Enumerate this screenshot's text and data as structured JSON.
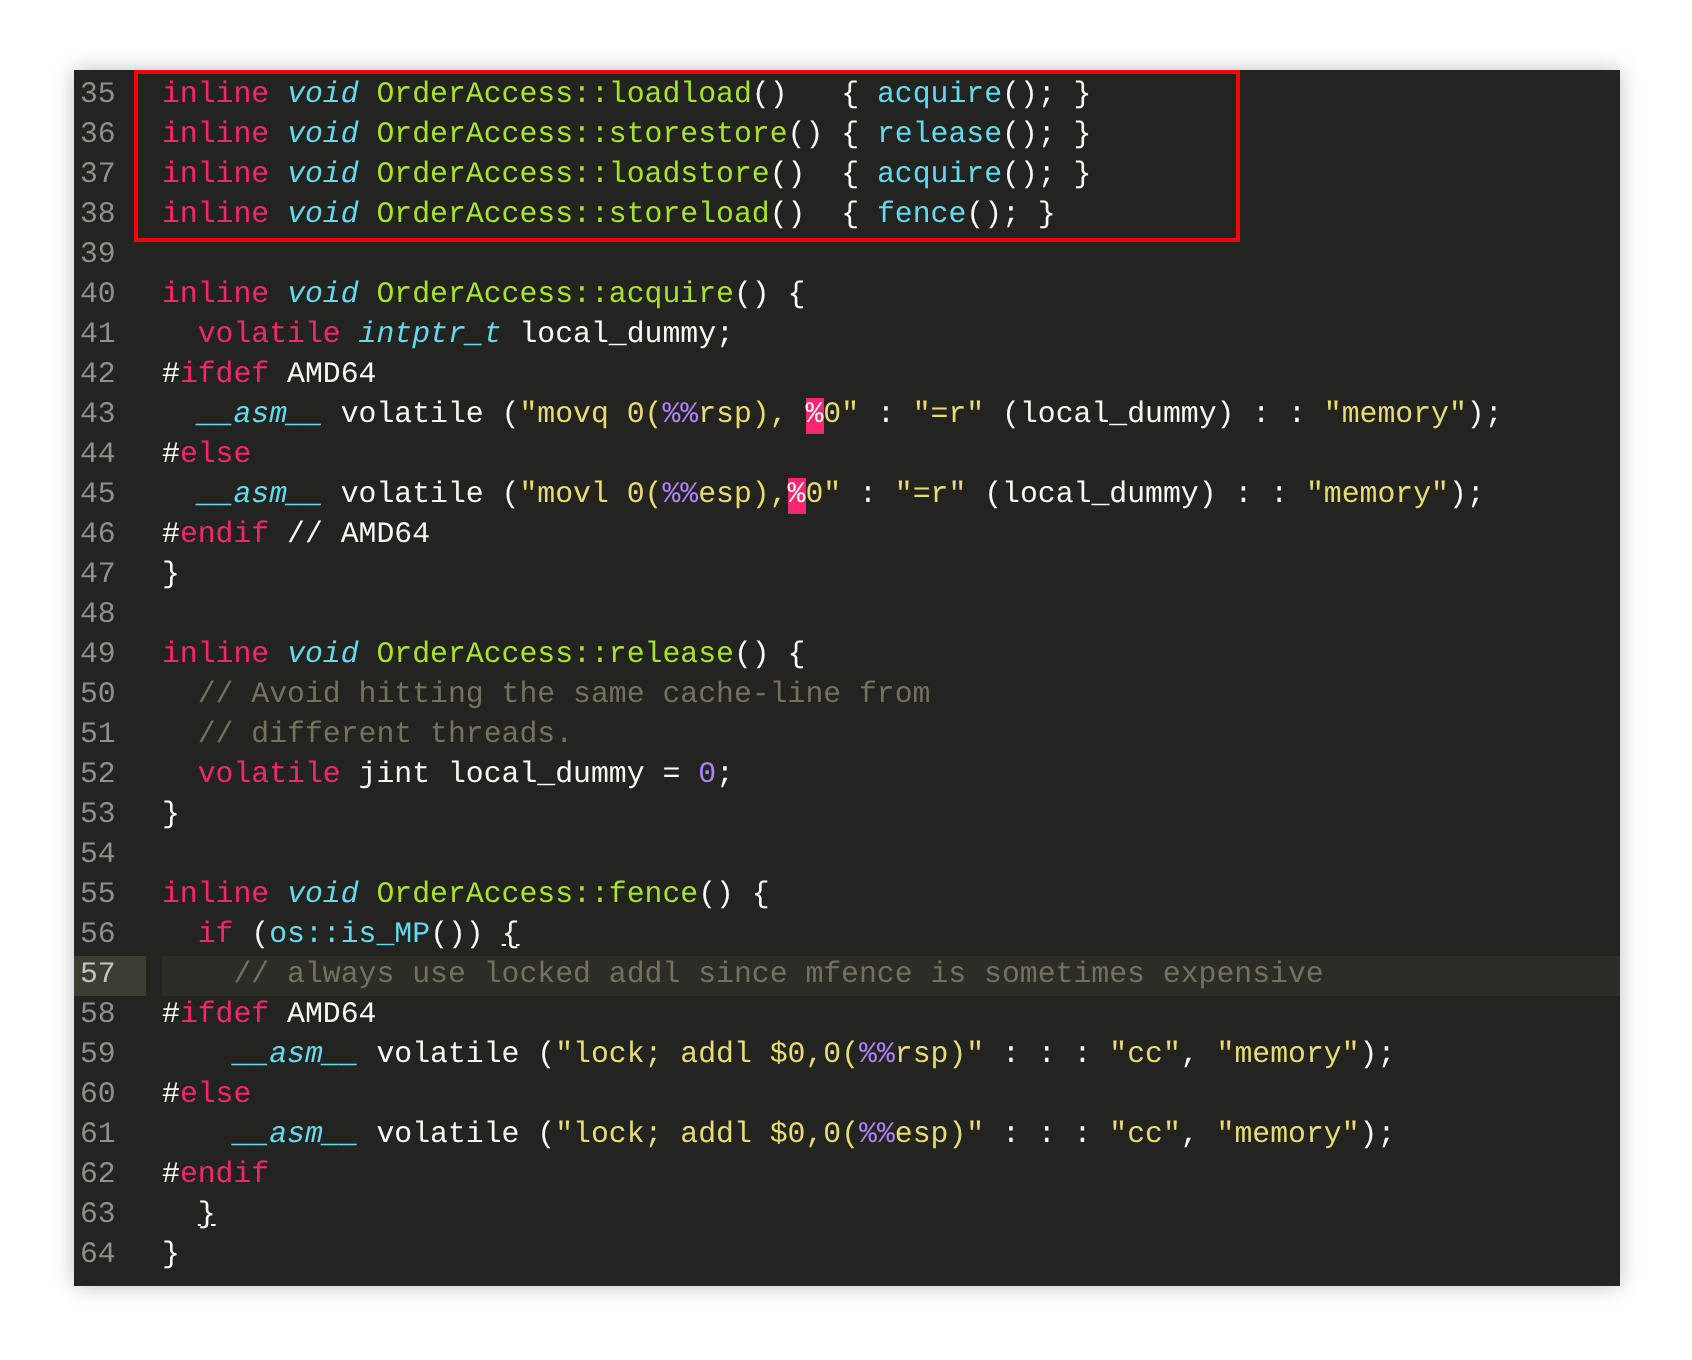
{
  "editor": {
    "lines": [
      {
        "number": "35",
        "current": false,
        "boxed": true,
        "tokens": [
          {
            "kind": "keyword",
            "t": "inline "
          },
          {
            "kind": "type",
            "t": "void"
          },
          {
            "kind": "function",
            "t": " OrderAccess::loadload"
          },
          {
            "kind": "plain",
            "t": "()   { "
          },
          {
            "kind": "call",
            "t": "acquire"
          },
          {
            "kind": "plain",
            "t": "(); }"
          }
        ]
      },
      {
        "number": "36",
        "current": false,
        "boxed": true,
        "tokens": [
          {
            "kind": "keyword",
            "t": "inline "
          },
          {
            "kind": "type",
            "t": "void"
          },
          {
            "kind": "function",
            "t": " OrderAccess::storestore"
          },
          {
            "kind": "plain",
            "t": "() { "
          },
          {
            "kind": "call",
            "t": "release"
          },
          {
            "kind": "plain",
            "t": "(); }"
          }
        ]
      },
      {
        "number": "37",
        "current": false,
        "boxed": true,
        "tokens": [
          {
            "kind": "keyword",
            "t": "inline "
          },
          {
            "kind": "type",
            "t": "void"
          },
          {
            "kind": "function",
            "t": " OrderAccess::loadstore"
          },
          {
            "kind": "plain",
            "t": "()  { "
          },
          {
            "kind": "call",
            "t": "acquire"
          },
          {
            "kind": "plain",
            "t": "(); }"
          }
        ]
      },
      {
        "number": "38",
        "current": false,
        "boxed": true,
        "tokens": [
          {
            "kind": "keyword",
            "t": "inline "
          },
          {
            "kind": "type",
            "t": "void"
          },
          {
            "kind": "function",
            "t": " OrderAccess::storeload"
          },
          {
            "kind": "plain",
            "t": "()  { "
          },
          {
            "kind": "call",
            "t": "fence"
          },
          {
            "kind": "plain",
            "t": "(); }"
          }
        ]
      },
      {
        "number": "39",
        "current": false
      },
      {
        "number": "40",
        "current": false,
        "tokens": [
          {
            "kind": "keyword",
            "t": "inline "
          },
          {
            "kind": "type",
            "t": "void"
          },
          {
            "kind": "function",
            "t": " OrderAccess::acquire"
          },
          {
            "kind": "plain",
            "t": "() {"
          }
        ]
      },
      {
        "number": "41",
        "current": false,
        "tokens": [
          {
            "kind": "keyword",
            "t": "  volatile "
          },
          {
            "kind": "type",
            "t": "intptr_t"
          },
          {
            "kind": "plain",
            "t": " local_dummy;"
          }
        ]
      },
      {
        "number": "42",
        "current": false,
        "tokens": [
          {
            "kind": "plain",
            "t": "#"
          },
          {
            "kind": "keyword",
            "t": "ifdef"
          },
          {
            "kind": "plain",
            "t": " AMD64"
          }
        ]
      },
      {
        "number": "43",
        "current": false,
        "tokens": [
          {
            "kind": "type",
            "t": "  __asm__"
          },
          {
            "kind": "plain",
            "t": " volatile ("
          },
          {
            "kind": "string",
            "t": "\"movq 0("
          },
          {
            "kind": "escape",
            "t": "%%"
          },
          {
            "kind": "string",
            "t": "rsp), "
          },
          {
            "kind": "invalid",
            "t": "%"
          },
          {
            "kind": "string",
            "t": "0\""
          },
          {
            "kind": "plain",
            "t": " : "
          },
          {
            "kind": "string",
            "t": "\"=r\""
          },
          {
            "kind": "plain",
            "t": " (local_dummy) : : "
          },
          {
            "kind": "string",
            "t": "\"memory\""
          },
          {
            "kind": "plain",
            "t": ");"
          }
        ]
      },
      {
        "number": "44",
        "current": false,
        "tokens": [
          {
            "kind": "plain",
            "t": "#"
          },
          {
            "kind": "keyword",
            "t": "else"
          }
        ]
      },
      {
        "number": "45",
        "current": false,
        "tokens": [
          {
            "kind": "type",
            "t": "  __asm__"
          },
          {
            "kind": "plain",
            "t": " volatile ("
          },
          {
            "kind": "string",
            "t": "\"movl 0("
          },
          {
            "kind": "escape",
            "t": "%%"
          },
          {
            "kind": "string",
            "t": "esp),"
          },
          {
            "kind": "invalid",
            "t": "%"
          },
          {
            "kind": "string",
            "t": "0\""
          },
          {
            "kind": "plain",
            "t": " : "
          },
          {
            "kind": "string",
            "t": "\"=r\""
          },
          {
            "kind": "plain",
            "t": " (local_dummy) : : "
          },
          {
            "kind": "string",
            "t": "\"memory\""
          },
          {
            "kind": "plain",
            "t": ");"
          }
        ]
      },
      {
        "number": "46",
        "current": false,
        "tokens": [
          {
            "kind": "plain",
            "t": "#"
          },
          {
            "kind": "keyword",
            "t": "endif"
          },
          {
            "kind": "plain",
            "t": " // AMD64"
          }
        ]
      },
      {
        "number": "47",
        "current": false,
        "tokens": [
          {
            "kind": "plain",
            "t": "}"
          }
        ]
      },
      {
        "number": "48",
        "current": false
      },
      {
        "number": "49",
        "current": false,
        "tokens": [
          {
            "kind": "keyword",
            "t": "inline "
          },
          {
            "kind": "type",
            "t": "void"
          },
          {
            "kind": "function",
            "t": " OrderAccess::release"
          },
          {
            "kind": "plain",
            "t": "() {"
          }
        ]
      },
      {
        "number": "50",
        "current": false,
        "tokens": [
          {
            "kind": "comment",
            "t": "  // Avoid hitting the same cache-line from"
          }
        ]
      },
      {
        "number": "51",
        "current": false,
        "tokens": [
          {
            "kind": "comment",
            "t": "  // different threads."
          }
        ]
      },
      {
        "number": "52",
        "current": false,
        "tokens": [
          {
            "kind": "keyword",
            "t": "  volatile"
          },
          {
            "kind": "plain",
            "t": " jint local_dummy = "
          },
          {
            "kind": "number",
            "t": "0"
          },
          {
            "kind": "plain",
            "t": ";"
          }
        ]
      },
      {
        "number": "53",
        "current": false,
        "tokens": [
          {
            "kind": "plain",
            "t": "}"
          }
        ]
      },
      {
        "number": "54",
        "current": false
      },
      {
        "number": "55",
        "current": false,
        "tokens": [
          {
            "kind": "keyword",
            "t": "inline "
          },
          {
            "kind": "type",
            "t": "void"
          },
          {
            "kind": "function",
            "t": " OrderAccess::fence"
          },
          {
            "kind": "plain",
            "t": "() {"
          }
        ]
      },
      {
        "number": "56",
        "current": false,
        "tokens": [
          {
            "kind": "keyword",
            "t": "  if"
          },
          {
            "kind": "plain",
            "t": " ("
          },
          {
            "kind": "call",
            "t": "os::is_MP"
          },
          {
            "kind": "plain",
            "t": "()) "
          },
          {
            "kind": "match",
            "t": "{"
          }
        ]
      },
      {
        "number": "57",
        "current": true,
        "tokens": [
          {
            "kind": "comment",
            "t": "    // always use locked addl since mfence is sometimes expensive"
          }
        ]
      },
      {
        "number": "58",
        "current": false,
        "tokens": [
          {
            "kind": "plain",
            "t": "#"
          },
          {
            "kind": "keyword",
            "t": "ifdef"
          },
          {
            "kind": "plain",
            "t": " AMD64"
          }
        ]
      },
      {
        "number": "59",
        "current": false,
        "tokens": [
          {
            "kind": "type",
            "t": "    __asm__"
          },
          {
            "kind": "plain",
            "t": " volatile ("
          },
          {
            "kind": "string",
            "t": "\"lock; addl $0,0("
          },
          {
            "kind": "escape",
            "t": "%%"
          },
          {
            "kind": "string",
            "t": "rsp)\""
          },
          {
            "kind": "plain",
            "t": " : : : "
          },
          {
            "kind": "string",
            "t": "\"cc\""
          },
          {
            "kind": "plain",
            "t": ", "
          },
          {
            "kind": "string",
            "t": "\"memory\""
          },
          {
            "kind": "plain",
            "t": ");"
          }
        ]
      },
      {
        "number": "60",
        "current": false,
        "tokens": [
          {
            "kind": "plain",
            "t": "#"
          },
          {
            "kind": "keyword",
            "t": "else"
          }
        ]
      },
      {
        "number": "61",
        "current": false,
        "tokens": [
          {
            "kind": "type",
            "t": "    __asm__"
          },
          {
            "kind": "plain",
            "t": " volatile ("
          },
          {
            "kind": "string",
            "t": "\"lock; addl $0,0("
          },
          {
            "kind": "escape",
            "t": "%%"
          },
          {
            "kind": "string",
            "t": "esp)\""
          },
          {
            "kind": "plain",
            "t": " : : : "
          },
          {
            "kind": "string",
            "t": "\"cc\""
          },
          {
            "kind": "plain",
            "t": ", "
          },
          {
            "kind": "string",
            "t": "\"memory\""
          },
          {
            "kind": "plain",
            "t": ");"
          }
        ]
      },
      {
        "number": "62",
        "current": false,
        "tokens": [
          {
            "kind": "plain",
            "t": "#"
          },
          {
            "kind": "keyword",
            "t": "endif"
          }
        ]
      },
      {
        "number": "63",
        "current": false,
        "tokens": [
          {
            "kind": "match",
            "t": "  }"
          }
        ]
      },
      {
        "number": "64",
        "current": false,
        "tokens": [
          {
            "kind": "plain",
            "t": "}"
          }
        ]
      }
    ]
  }
}
